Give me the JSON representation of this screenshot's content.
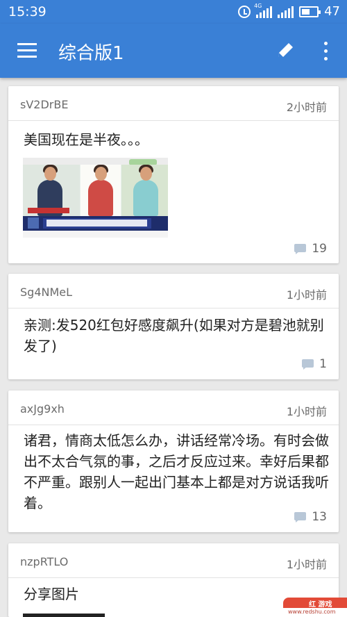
{
  "statusbar": {
    "time": "15:39",
    "network": "4G",
    "battery_percent": "47"
  },
  "appbar": {
    "title": "综合版1",
    "menu_icon": "hamburger-menu-icon",
    "edit_icon": "pencil-edit-icon",
    "more_icon": "vertical-ellipsis-icon",
    "background": "#3a80d6"
  },
  "posts": [
    {
      "author": "sV2DrBE",
      "time": "2小时前",
      "content": "美国现在是半夜。。。",
      "comments": "19",
      "has_image": true
    },
    {
      "author": "Sg4NMeL",
      "time": "1小时前",
      "content": "亲测:发520红包好感度飙升(如果对方是碧池就别发了)",
      "comments": "1",
      "has_image": false
    },
    {
      "author": "axJg9xh",
      "time": "1小时前",
      "content": "诸君，情商太低怎么办，讲话经常冷场。有时会做出不太合气氛的事，之后才反应过来。幸好后果都不严重。跟别人一起出门基本上都是对方说话我听着。",
      "comments": "13",
      "has_image": false
    },
    {
      "author": "nzpRTLO",
      "time": "1小时前",
      "content": "分享图片",
      "has_image": true
    }
  ],
  "watermark": {
    "title": "红 游戏",
    "url": "www.redshu.com"
  }
}
